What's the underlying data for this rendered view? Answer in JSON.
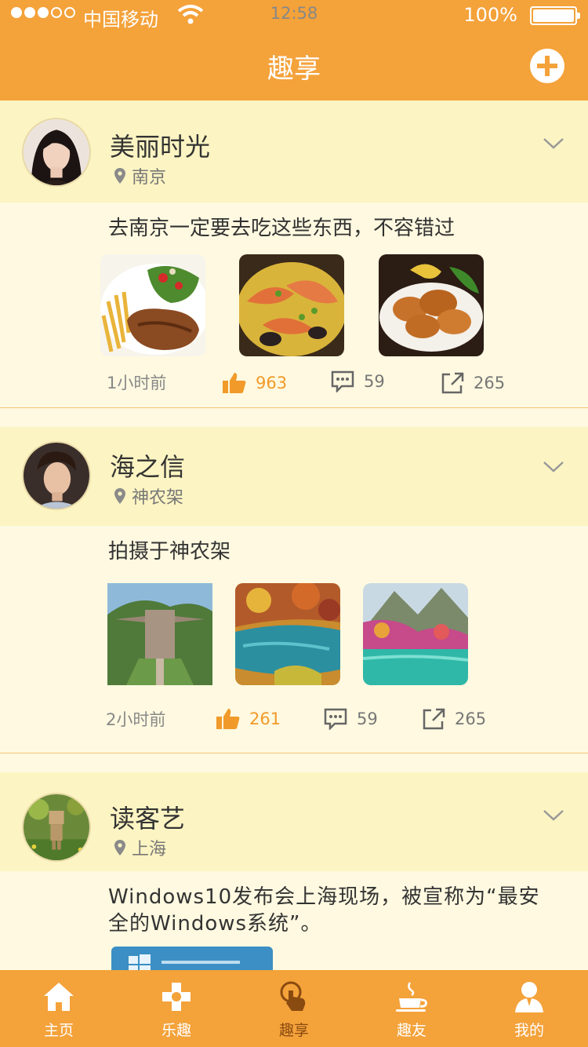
{
  "status": {
    "carrier": "中国移动",
    "time": "12:58",
    "battery_text": "100%"
  },
  "nav": {
    "title": "趣享",
    "add_icon": "plus-circle-icon"
  },
  "posts": [
    {
      "user": "美丽时光",
      "location": "南京",
      "caption": "去南京一定要去吃这些东西，不容错过",
      "time": "1小时前",
      "likes": "963",
      "comments": "59",
      "shares": "265"
    },
    {
      "user": "海之信",
      "location": "神农架",
      "caption": "拍摄于神农架",
      "time": "2小时前",
      "likes": "261",
      "comments": "59",
      "shares": "265"
    },
    {
      "user": "读客艺",
      "location": "上海",
      "caption": "Windows10发布会上海现场，被宣称为“最安全的Windows系统”。"
    }
  ],
  "tabs": [
    {
      "label": "主页",
      "icon": "home-icon"
    },
    {
      "label": "乐趣",
      "icon": "gamepad-icon"
    },
    {
      "label": "趣享",
      "icon": "tap-hand-icon"
    },
    {
      "label": "趣友",
      "icon": "coffee-cup-icon"
    },
    {
      "label": "我的",
      "icon": "user-icon"
    }
  ],
  "colors": {
    "primary": "#f4a23a",
    "header_bg": "#fcf4c2",
    "card_bg": "#fef9e0",
    "like": "#f19a2a",
    "active_tab": "#8a4b10"
  }
}
